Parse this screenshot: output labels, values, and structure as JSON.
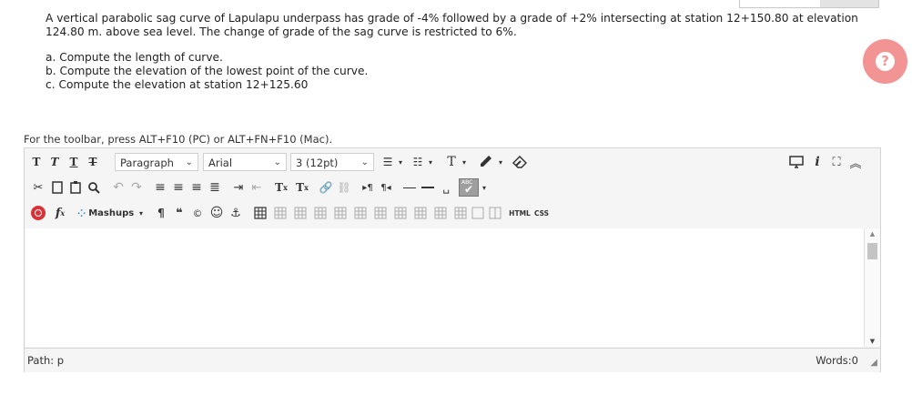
{
  "question": {
    "line1": "A vertical parabolic sag curve of Lapulapu underpass has grade of -4% followed by a grade of +2% intersecting at station 12+150.80 at elevation",
    "line2": "124.80 m. above sea level. The change of grade of the sag curve is restricted to 6%.",
    "parts": [
      "a. Compute the length of curve.",
      "b. Compute the elevation of the lowest point of the curve.",
      "c. Compute the elevation at station 12+125.60"
    ]
  },
  "help_icon": "question-mark-icon",
  "toolbar_hint": "For the toolbar, press ALT+F10 (PC) or ALT+FN+F10 (Mac).",
  "toolbar": {
    "paragraph": "Paragraph",
    "font": "Arial",
    "size": "3 (12pt)",
    "mashups": "Mashups",
    "html": "HTML",
    "css": "CSS",
    "spell_label": "ABC"
  },
  "status": {
    "path": "Path: p",
    "words": "Words:0"
  },
  "colors": {
    "help": "#f29494",
    "toolbar_bg": "#f5f5f5",
    "spell_bg": "#9e9e9e",
    "mashups_bg": "#3a8fd8",
    "fx_bg": "#d9313a"
  }
}
